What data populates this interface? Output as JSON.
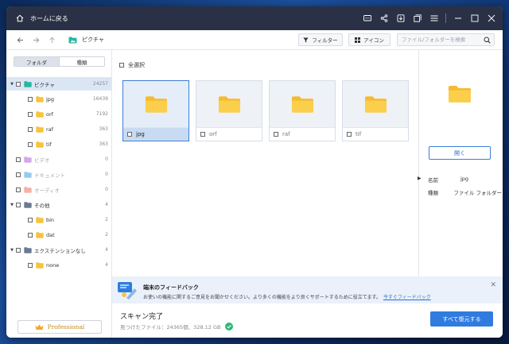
{
  "titlebar": {
    "home_label": "ホームに戻る",
    "icons": [
      "feedback-icon",
      "share-icon",
      "download-icon",
      "restore-window-icon",
      "menu-icon",
      "minimize-icon",
      "maximize-icon",
      "close-icon"
    ]
  },
  "toolbar": {
    "breadcrumb": "ピクチャ",
    "filter_label": "フィルター",
    "view_label": "アイコン",
    "search_placeholder": "ファイル/フォルダーを検索"
  },
  "left": {
    "tabs": [
      "フォルダ",
      "種類"
    ],
    "active_tab": 0,
    "tree": [
      {
        "label": "ピクチャ",
        "count": "24257",
        "level": 0,
        "expanded": true,
        "selected": true,
        "icon": "picture-folder-icon"
      },
      {
        "label": "jpg",
        "count": "16439",
        "level": 1
      },
      {
        "label": "orf",
        "count": "7192",
        "level": 1
      },
      {
        "label": "raf",
        "count": "363",
        "level": 1
      },
      {
        "label": "tif",
        "count": "363",
        "level": 1
      },
      {
        "label": "ビデオ",
        "count": "0",
        "level": 0,
        "dim": true,
        "icon": "video-folder-icon"
      },
      {
        "label": "ドキュメント",
        "count": "0",
        "level": 0,
        "dim": true,
        "icon": "document-folder-icon"
      },
      {
        "label": "オーディオ",
        "count": "0",
        "level": 0,
        "dim": true,
        "icon": "audio-folder-icon"
      },
      {
        "label": "その他",
        "count": "4",
        "level": 0,
        "expanded": true,
        "icon": "other-folder-icon"
      },
      {
        "label": "bin",
        "count": "2",
        "level": 1
      },
      {
        "label": "dat",
        "count": "2",
        "level": 1
      },
      {
        "label": "エクステンションなし",
        "count": "4",
        "level": 0,
        "expanded": true,
        "icon": "no-extension-folder-icon"
      },
      {
        "label": "none",
        "count": "4",
        "level": 1
      }
    ],
    "pro_label": "Professional"
  },
  "center": {
    "select_all_label": "全選択",
    "tiles": [
      {
        "label": "jpg",
        "selected": true
      },
      {
        "label": "orf",
        "selected": false
      },
      {
        "label": "raf",
        "selected": false
      },
      {
        "label": "tif",
        "selected": false
      }
    ]
  },
  "details": {
    "open_label": "開く",
    "name_key": "名前",
    "name_value": "jpg",
    "type_key": "種類",
    "type_value": "ファイル フォルダー"
  },
  "feedback": {
    "title": "端末のフィードバック",
    "text": "お使いの機能に関するご意見をお聞かせください。より多くの機能をより良くサポートするために役立てます。",
    "link": "今すぐフィードバック"
  },
  "status": {
    "title": "スキャン完了",
    "found": "見つけたファイル：24365個、328.12 GB",
    "restore_all_label": "すべて復元する"
  },
  "colors": {
    "accent": "#2f7be0",
    "folder": "#f6c33c",
    "titlebar": "#2a3146",
    "selected_row": "#dbe6f5"
  }
}
